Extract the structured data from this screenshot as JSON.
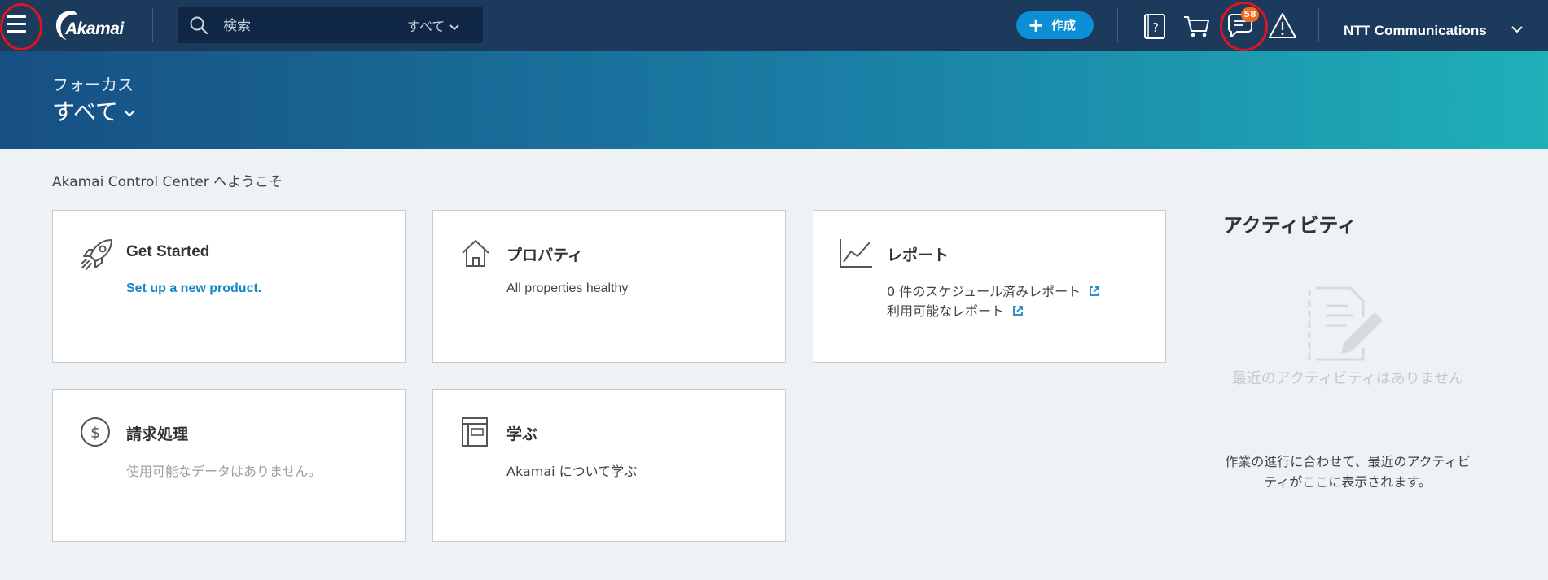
{
  "header": {
    "logo_text": "Akamai",
    "search_placeholder": "検索",
    "search_scope": "すべて",
    "create_label": "作成",
    "notification_count": "58",
    "account_name": "NTT Communications"
  },
  "banner": {
    "focus_label": "フォーカス",
    "focus_value": "すべて"
  },
  "main": {
    "welcome": "Akamai Control Center へようこそ",
    "cards": {
      "get_started": {
        "title": "Get Started",
        "link": "Set up a new product."
      },
      "properties": {
        "title": "プロパティ",
        "subtitle": "All properties healthy"
      },
      "reports": {
        "title": "レポート",
        "line1": "0 件のスケジュール済みレポート",
        "line2": "利用可能なレポート"
      },
      "billing": {
        "title": "請求処理",
        "subtitle": "使用可能なデータはありません。"
      },
      "learn": {
        "title": "学ぶ",
        "subtitle": "Akamai について学ぶ"
      }
    }
  },
  "activity": {
    "title": "アクティビティ",
    "empty_message": "最近のアクティビティはありません",
    "description": "作業の進行に合わせて、最近のアクティビティがここに表示されます。"
  },
  "colors": {
    "nav_bg": "#1b3a5c",
    "accent_blue": "#0d8fd6",
    "link_blue": "#1285c6",
    "badge_orange": "#f26b21",
    "annotation_red": "#e0141e"
  }
}
